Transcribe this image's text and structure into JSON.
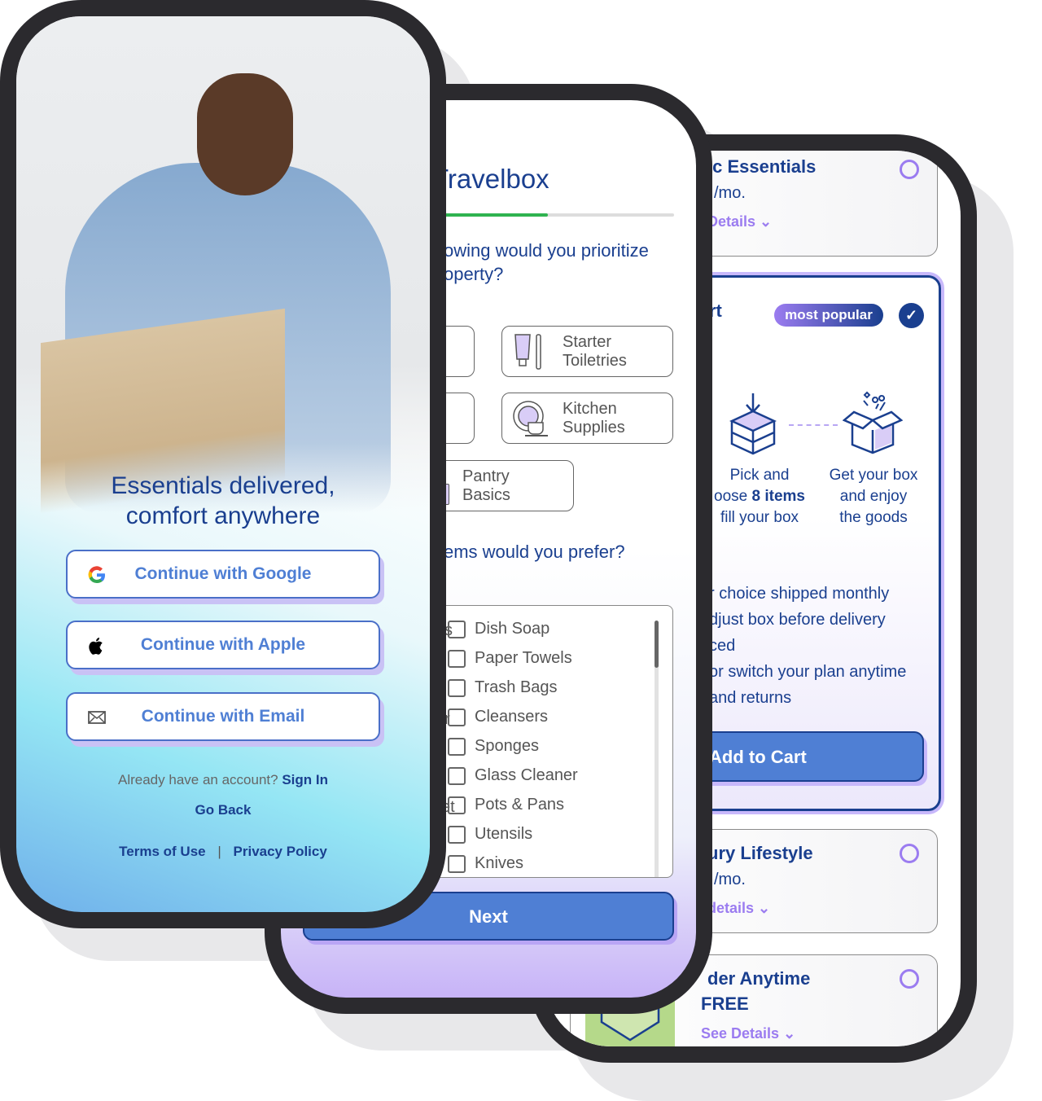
{
  "colors": {
    "brand_navy": "#1a3f8f",
    "primary_button": "#4f7fd4",
    "accent_purple": "#9b7cf0",
    "progress_green": "#2fb350",
    "frame": "#2b2a2e"
  },
  "plans_screen": {
    "cards": [
      {
        "title": "ic Essentials",
        "price": "/mo.",
        "details": "Details",
        "selected": false
      },
      {
        "title": "rt",
        "badge": "most popular",
        "selected": true,
        "steps": [
          {
            "lines": [
              "Pick and",
              "oose ",
              "8 items",
              " fill your box"
            ]
          },
          {
            "lines": [
              "Get your box",
              "and enjoy",
              "the goods"
            ]
          }
        ],
        "features": [
          "r choice shipped monthly",
          "djust box before delivery",
          "ced",
          "or switch your plan anytime",
          "and returns"
        ],
        "cta": "Add to Cart"
      },
      {
        "title": "ury Lifestyle",
        "price": "/mo.",
        "details": "details",
        "selected": false
      },
      {
        "title": "der Anytime",
        "price": "FREE",
        "details": "See Details",
        "selected": false
      }
    ]
  },
  "quiz_screen": {
    "title": "Travelbox",
    "progress": 0.66,
    "question1": [
      "owing would you prioritize",
      "operty?"
    ],
    "options": [
      {
        "label": "Starter Toiletries",
        "icon": "toiletries-icon"
      },
      {
        "label": "Kitchen Supplies",
        "icon": "kitchen-icon"
      },
      {
        "label": "Pantry Basics",
        "icon": "pantry-icon"
      }
    ],
    "question2": "ems would you prefer?",
    "left_fragments": [
      "s",
      "r",
      "et"
    ],
    "items": [
      "Dish Soap",
      "Paper Towels",
      "Trash Bags",
      "Cleansers",
      "Sponges",
      "Glass Cleaner",
      "Pots & Pans",
      "Utensils",
      "Knives"
    ],
    "next": "Next"
  },
  "signin_screen": {
    "headline": [
      "Essentials delivered,",
      "comfort anywhere"
    ],
    "buttons": [
      {
        "label": "Continue with Google",
        "icon": "google-icon"
      },
      {
        "label": "Continue with Apple",
        "icon": "apple-icon"
      },
      {
        "label": "Continue with Email",
        "icon": "email-icon"
      }
    ],
    "have_account": "Already have an account?",
    "sign_in": "Sign In",
    "go_back": "Go Back",
    "terms": "Terms of Use",
    "separator": "|",
    "privacy": "Privacy Policy"
  }
}
